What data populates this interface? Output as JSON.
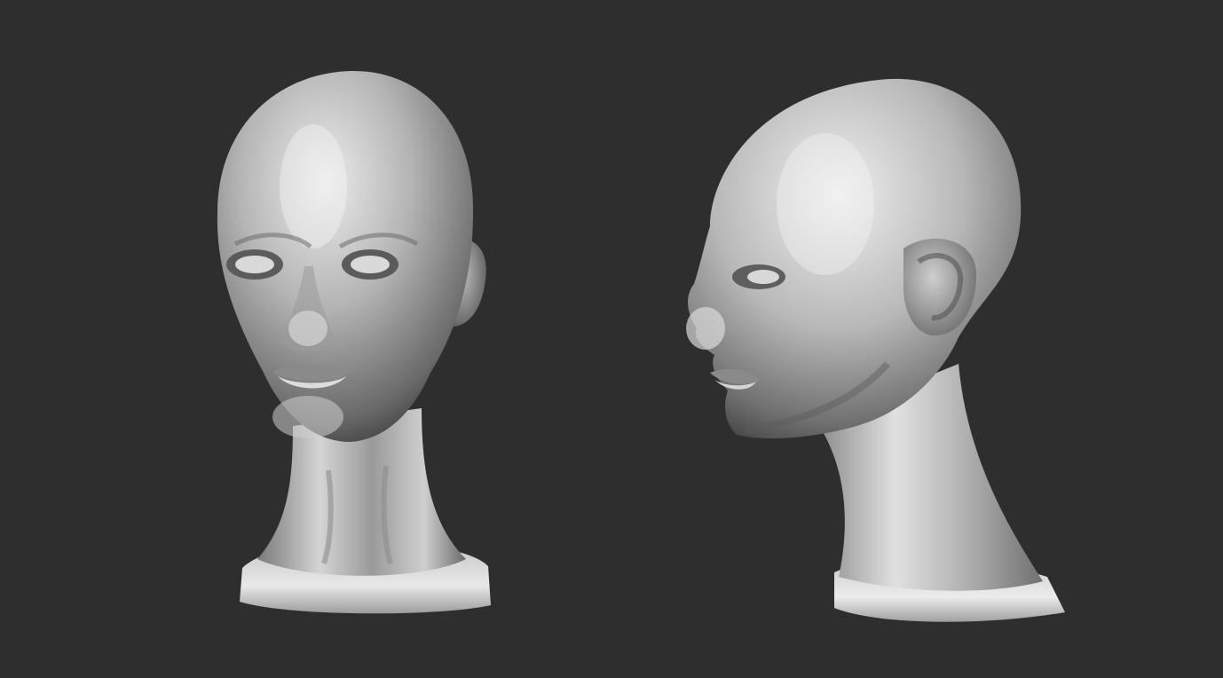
{
  "scene": {
    "background_color": "#2e2e2e",
    "material": "grey-clay-matcap",
    "models": [
      {
        "name": "head-front-view",
        "view": "front"
      },
      {
        "name": "head-profile-view",
        "view": "three-quarter-left"
      }
    ]
  },
  "colors": {
    "clay_highlight": "#e6e6e6",
    "clay_mid": "#a8a8a8",
    "clay_shadow": "#4a4a4a"
  }
}
